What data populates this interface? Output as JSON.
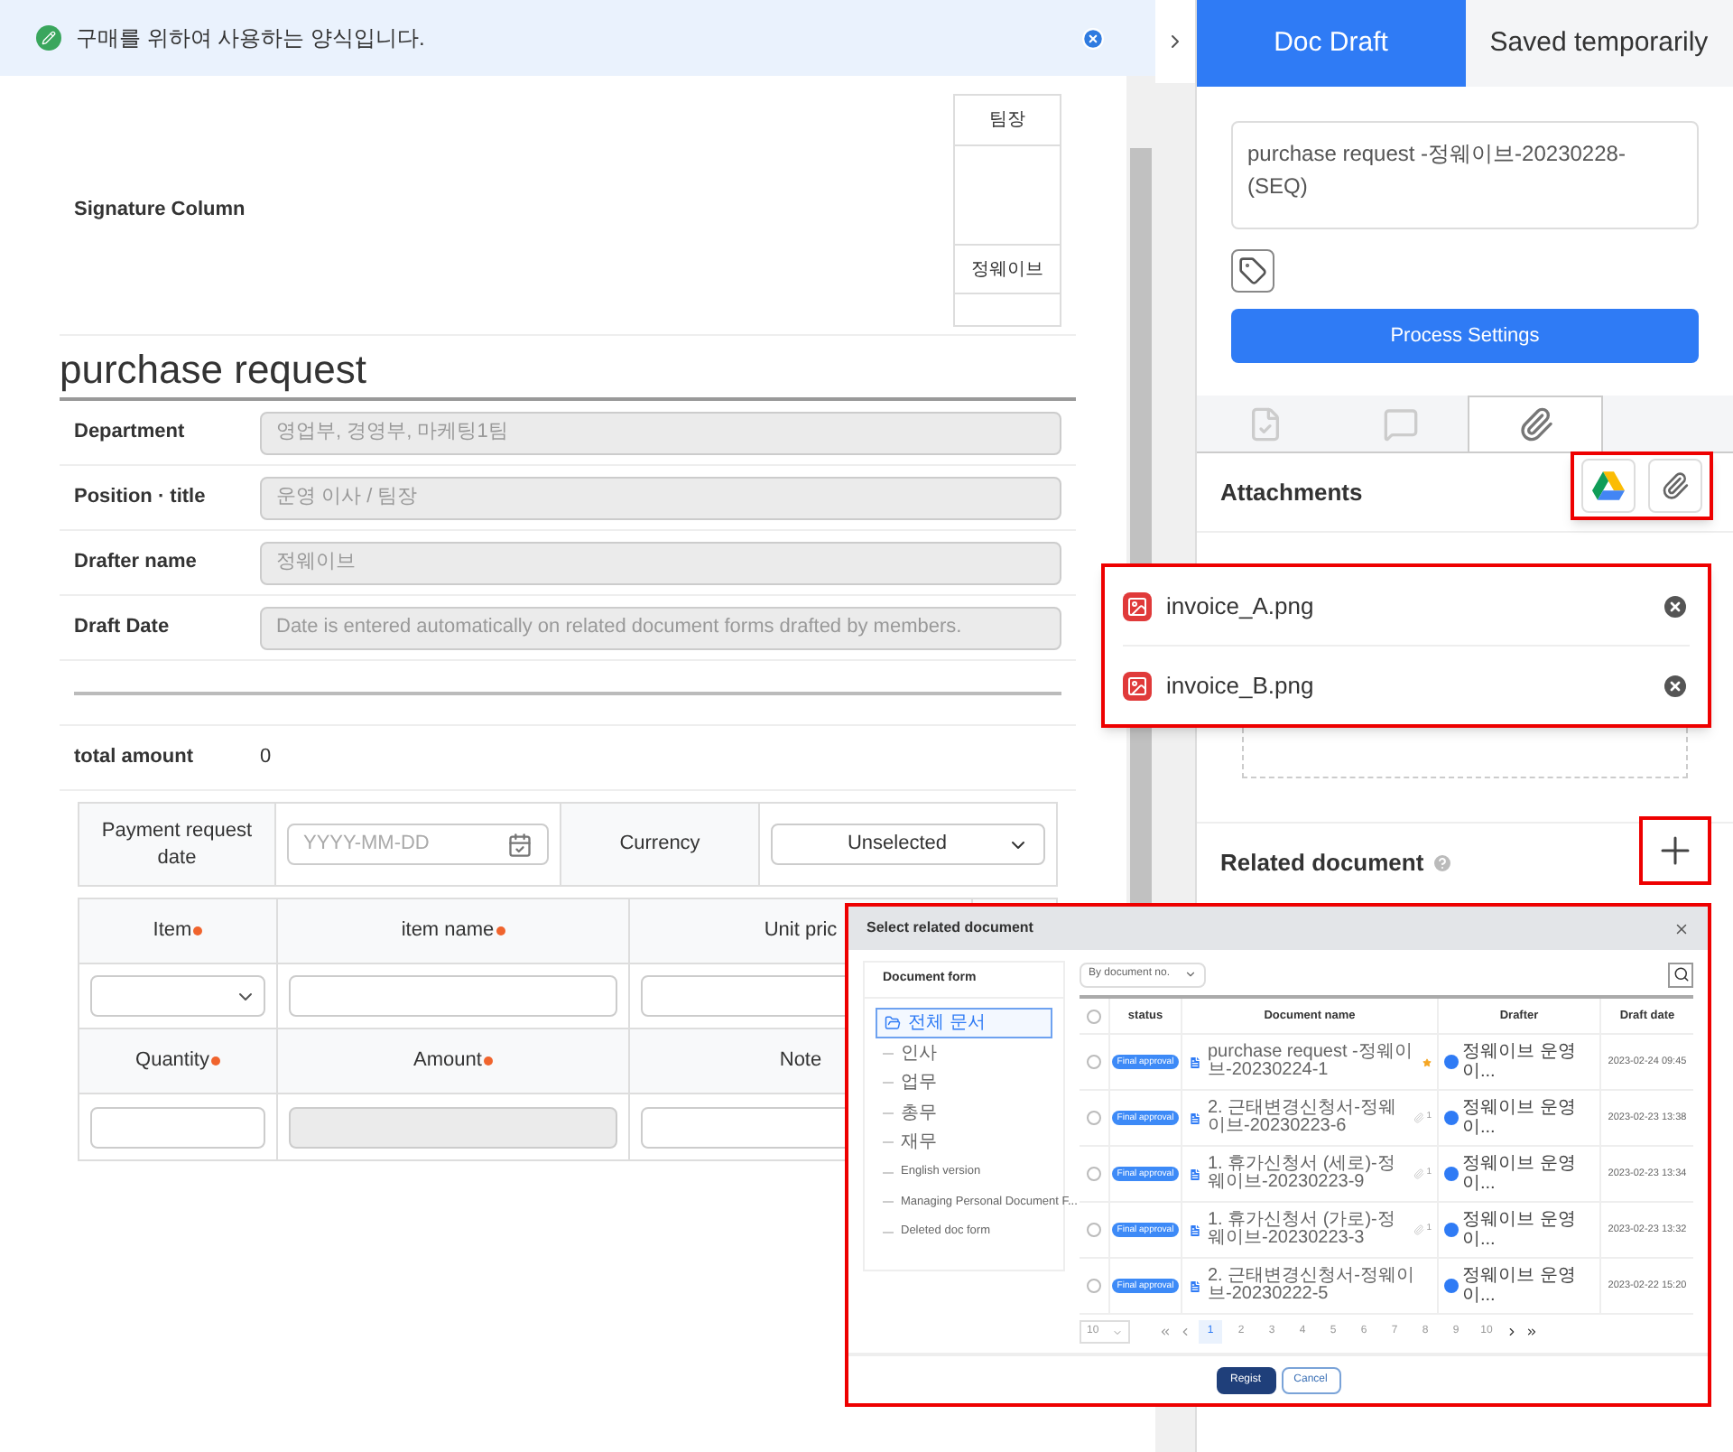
{
  "notice": {
    "text": "구매를 위하여 사용하는 양식입니다."
  },
  "signature": {
    "label": "Signature Column",
    "role": "팀장",
    "name": "정웨이브"
  },
  "form": {
    "title": "purchase request",
    "fields": [
      {
        "label": "Department",
        "value": "영업부, 경영부, 마케팅1팀"
      },
      {
        "label": "Position · title",
        "value": "운영 이사 / 팀장"
      },
      {
        "label": "Drafter name",
        "value": "정웨이브"
      },
      {
        "label": "Draft Date",
        "value": "Date is entered automatically on related document forms drafted by members."
      }
    ],
    "total": {
      "label": "total amount",
      "value": "0"
    },
    "payment": {
      "label": "Payment request date",
      "placeholder": "YYYY-MM-DD",
      "currency_label": "Currency",
      "currency_value": "Unselected"
    },
    "items": [
      {
        "label": "Item",
        "required": true,
        "kind": "select",
        "disabled": false
      },
      {
        "label": "item name",
        "required": true,
        "kind": "input",
        "disabled": false
      },
      {
        "label": "Unit pric",
        "required": false,
        "kind": "input",
        "disabled": false
      },
      {
        "label": "Quantity",
        "required": true,
        "kind": "input",
        "disabled": false
      },
      {
        "label": "Amount",
        "required": true,
        "kind": "input",
        "disabled": true
      },
      {
        "label": "Note",
        "required": false,
        "kind": "input",
        "disabled": false
      }
    ]
  },
  "panel": {
    "tabs": [
      {
        "label": "Doc Draft",
        "selected": true
      },
      {
        "label": "Saved temporarily",
        "selected": false
      }
    ],
    "title_value": "purchase request -정웨이브-20230228-(SEQ)",
    "process_button": "Process Settings",
    "icon_tabs": [
      {
        "kind": "approval",
        "selected": false
      },
      {
        "kind": "comment",
        "selected": false
      },
      {
        "kind": "attachment",
        "selected": true
      }
    ],
    "attachments_title": "Attachments",
    "files": [
      "invoice_A.png",
      "invoice_B.png"
    ],
    "related_title": "Related document"
  },
  "dialog": {
    "title": "Select related document",
    "tree_title": "Document form",
    "tree": [
      {
        "label": "전체 문서",
        "selected": true,
        "children": [
          {
            "label": "인사",
            "selected": false
          },
          {
            "label": "업무",
            "selected": false
          },
          {
            "label": "총무",
            "selected": false
          },
          {
            "label": "재무",
            "selected": false
          },
          {
            "label": "English version",
            "selected": false
          },
          {
            "label": "Managing Personal Document F...",
            "selected": false
          },
          {
            "label": "Deleted doc form",
            "selected": false
          }
        ]
      }
    ],
    "sort": "By document no.",
    "all_checked": false,
    "columns": [
      "status",
      "Document name",
      "Drafter",
      "Draft date"
    ],
    "rows": [
      {
        "status": "Final approval",
        "name": "purchase request -정웨이브-20230224-1",
        "checked": false,
        "flag": true,
        "attachment": "",
        "drafter": "정웨이브 운영 이...",
        "date": "2023-02-24 09:45"
      },
      {
        "status": "Final approval",
        "name": "2. 근태변경신청서-정웨이브-20230223-6",
        "checked": false,
        "flag": false,
        "attachment": "1",
        "drafter": "정웨이브 운영 이...",
        "date": "2023-02-23 13:38"
      },
      {
        "status": "Final approval",
        "name": "1. 휴가신청서 (세로)-정웨이브-20230223-9",
        "checked": false,
        "flag": false,
        "attachment": "1",
        "drafter": "정웨이브 운영 이...",
        "date": "2023-02-23 13:34"
      },
      {
        "status": "Final approval",
        "name": "1. 휴가신청서 (가로)-정웨이브-20230223-3",
        "checked": false,
        "flag": false,
        "attachment": "1",
        "drafter": "정웨이브 운영 이...",
        "date": "2023-02-23 13:32"
      },
      {
        "status": "Final approval",
        "name": "2. 근태변경신청서-정웨이브-20230222-5",
        "checked": false,
        "flag": false,
        "attachment": "",
        "drafter": "정웨이브 운영 이...",
        "date": "2023-02-22 15:20"
      }
    ],
    "page_size": "10",
    "pages": [
      {
        "label": "1",
        "selected": true
      },
      {
        "label": "2",
        "selected": false
      },
      {
        "label": "3",
        "selected": false
      },
      {
        "label": "4",
        "selected": false
      },
      {
        "label": "5",
        "selected": false
      },
      {
        "label": "6",
        "selected": false
      },
      {
        "label": "7",
        "selected": false
      },
      {
        "label": "8",
        "selected": false
      },
      {
        "label": "9",
        "selected": false
      },
      {
        "label": "10",
        "selected": false
      }
    ],
    "buttons": [
      {
        "label": "Regist",
        "kind": "primary"
      },
      {
        "label": "Cancel",
        "kind": "secondary"
      }
    ]
  }
}
